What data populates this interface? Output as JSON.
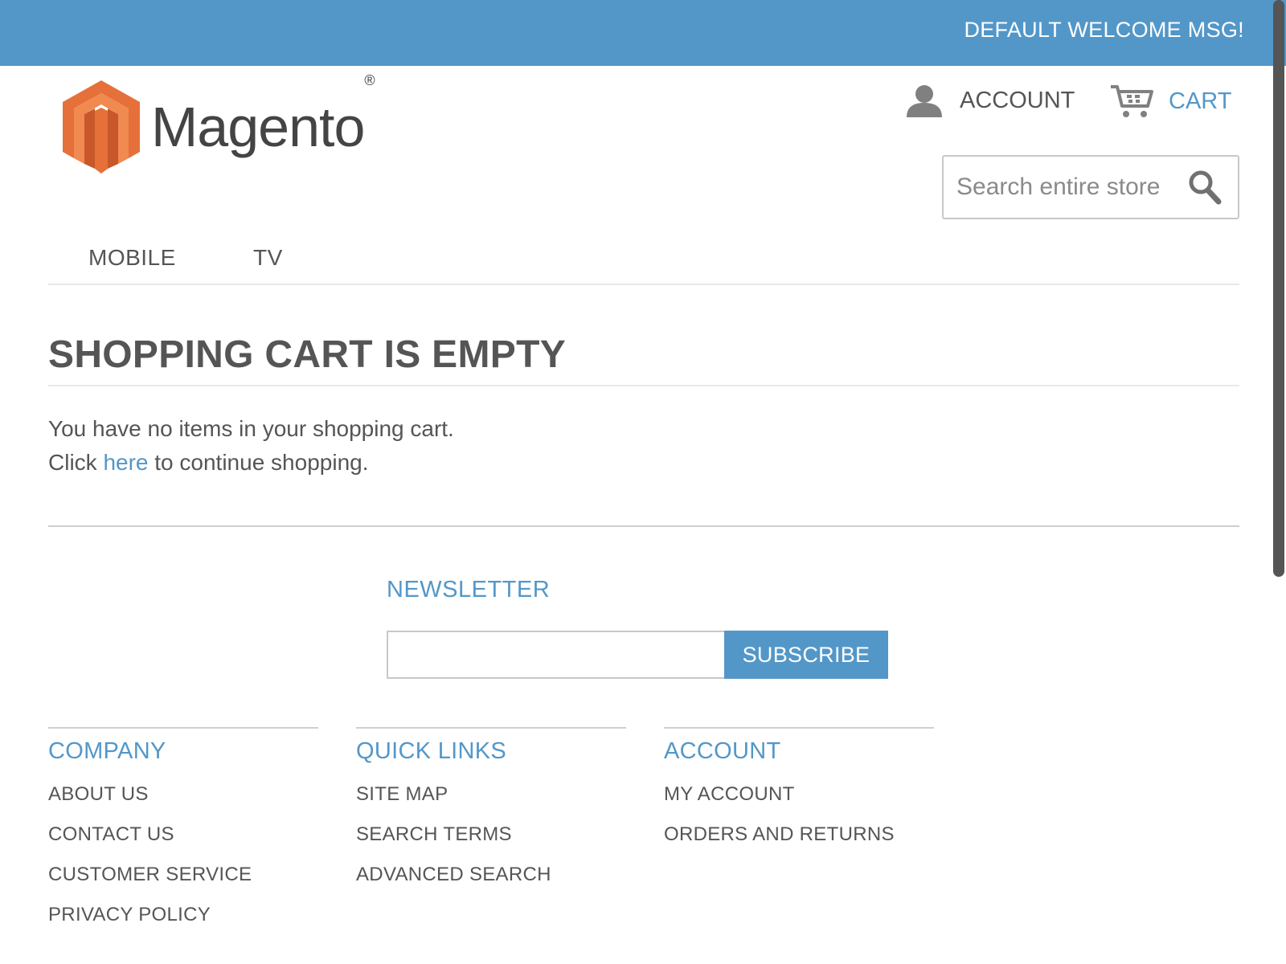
{
  "topbar": {
    "welcome": "DEFAULT WELCOME MSG!"
  },
  "header": {
    "logo_text": "Magento",
    "logo_reg": "®",
    "account_label": "ACCOUNT",
    "cart_label": "CART",
    "search_placeholder": "Search entire store"
  },
  "nav": {
    "items": [
      "MOBILE",
      "TV"
    ]
  },
  "main": {
    "title": "SHOPPING CART IS EMPTY",
    "line1": "You have no items in your shopping cart.",
    "line2_prefix": "Click",
    "line2_link": "here",
    "line2_suffix": "to continue shopping."
  },
  "newsletter": {
    "title": "NEWSLETTER",
    "button": "SUBSCRIBE"
  },
  "footer": {
    "columns": [
      {
        "title": "COMPANY",
        "links": [
          "ABOUT US",
          "CONTACT US",
          "CUSTOMER SERVICE",
          "PRIVACY POLICY"
        ]
      },
      {
        "title": "QUICK LINKS",
        "links": [
          "SITE MAP",
          "SEARCH TERMS",
          "ADVANCED SEARCH"
        ]
      },
      {
        "title": "ACCOUNT",
        "links": [
          "MY ACCOUNT",
          "ORDERS AND RETURNS"
        ]
      }
    ]
  },
  "colors": {
    "accent": "#5397c9",
    "text": "#555555",
    "logo_orange": "#e5703a"
  },
  "icons": {
    "account": "user-icon",
    "cart": "cart-icon",
    "search": "search-icon",
    "logo": "magento-logo-icon"
  }
}
